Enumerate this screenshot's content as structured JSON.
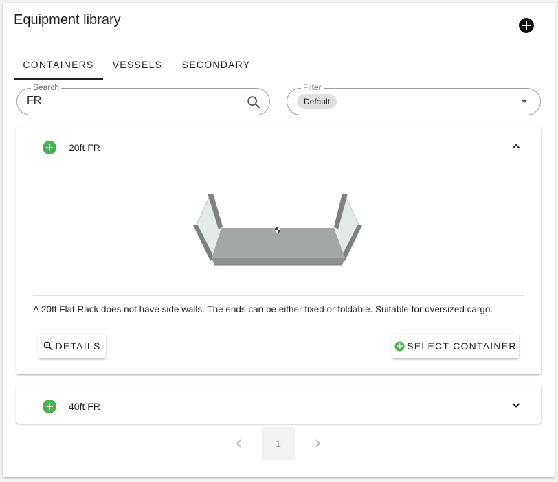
{
  "header": {
    "title": "Equipment library"
  },
  "tabs": [
    {
      "label": "CONTAINERS",
      "active": true
    },
    {
      "label": "VESSELS",
      "active": false
    },
    {
      "label": "SECONDARY",
      "active": false
    }
  ],
  "search": {
    "label": "Search",
    "value": "FR"
  },
  "filter": {
    "label": "Filter",
    "selected_chip": "Default"
  },
  "results": [
    {
      "title": "20ft FR",
      "expanded": true,
      "description": "A 20ft Flat Rack does not have side walls. The ends can be either fixed or foldable. Suitable for oversized cargo.",
      "details_label": "DETAILS",
      "select_label": "SELECT CONTAINER"
    },
    {
      "title": "40ft FR",
      "expanded": false
    }
  ],
  "pagination": {
    "current_page": "1"
  },
  "colors": {
    "accent_green": "#4caf50",
    "tab_indicator": "#222222"
  },
  "icons": {
    "add": "plus-circle-icon",
    "search": "magnifier-icon",
    "dropdown": "caret-down-icon",
    "expand": "chevron-down-icon",
    "collapse": "chevron-up-icon",
    "details": "zoom-in-icon",
    "select": "plus-circle-icon",
    "prev": "chevron-left-icon",
    "next": "chevron-right-icon"
  }
}
